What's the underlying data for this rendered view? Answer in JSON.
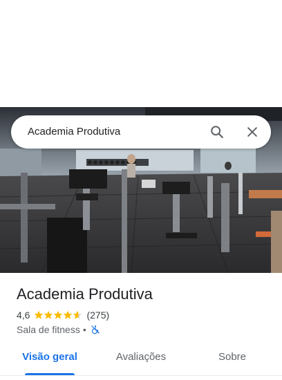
{
  "search": {
    "query": "Academia Produtiva",
    "search_icon": "search-icon",
    "close_icon": "close-icon"
  },
  "photo": {
    "subject": "gym-interior-photo"
  },
  "place": {
    "title": "Academia Produtiva",
    "rating": "4,6",
    "rating_value": 4.6,
    "stars_max": 5,
    "reviews_count": "(275)",
    "category": "Sala de fitness",
    "separator": "•",
    "accessibility_icon": "not-wheelchair-accessible-icon",
    "star_color": "#fbbc04",
    "accent_color": "#1a73e8"
  },
  "tabs": [
    {
      "label": "Visão geral",
      "active": true
    },
    {
      "label": "Avaliações",
      "active": false
    },
    {
      "label": "Sobre",
      "active": false
    }
  ]
}
